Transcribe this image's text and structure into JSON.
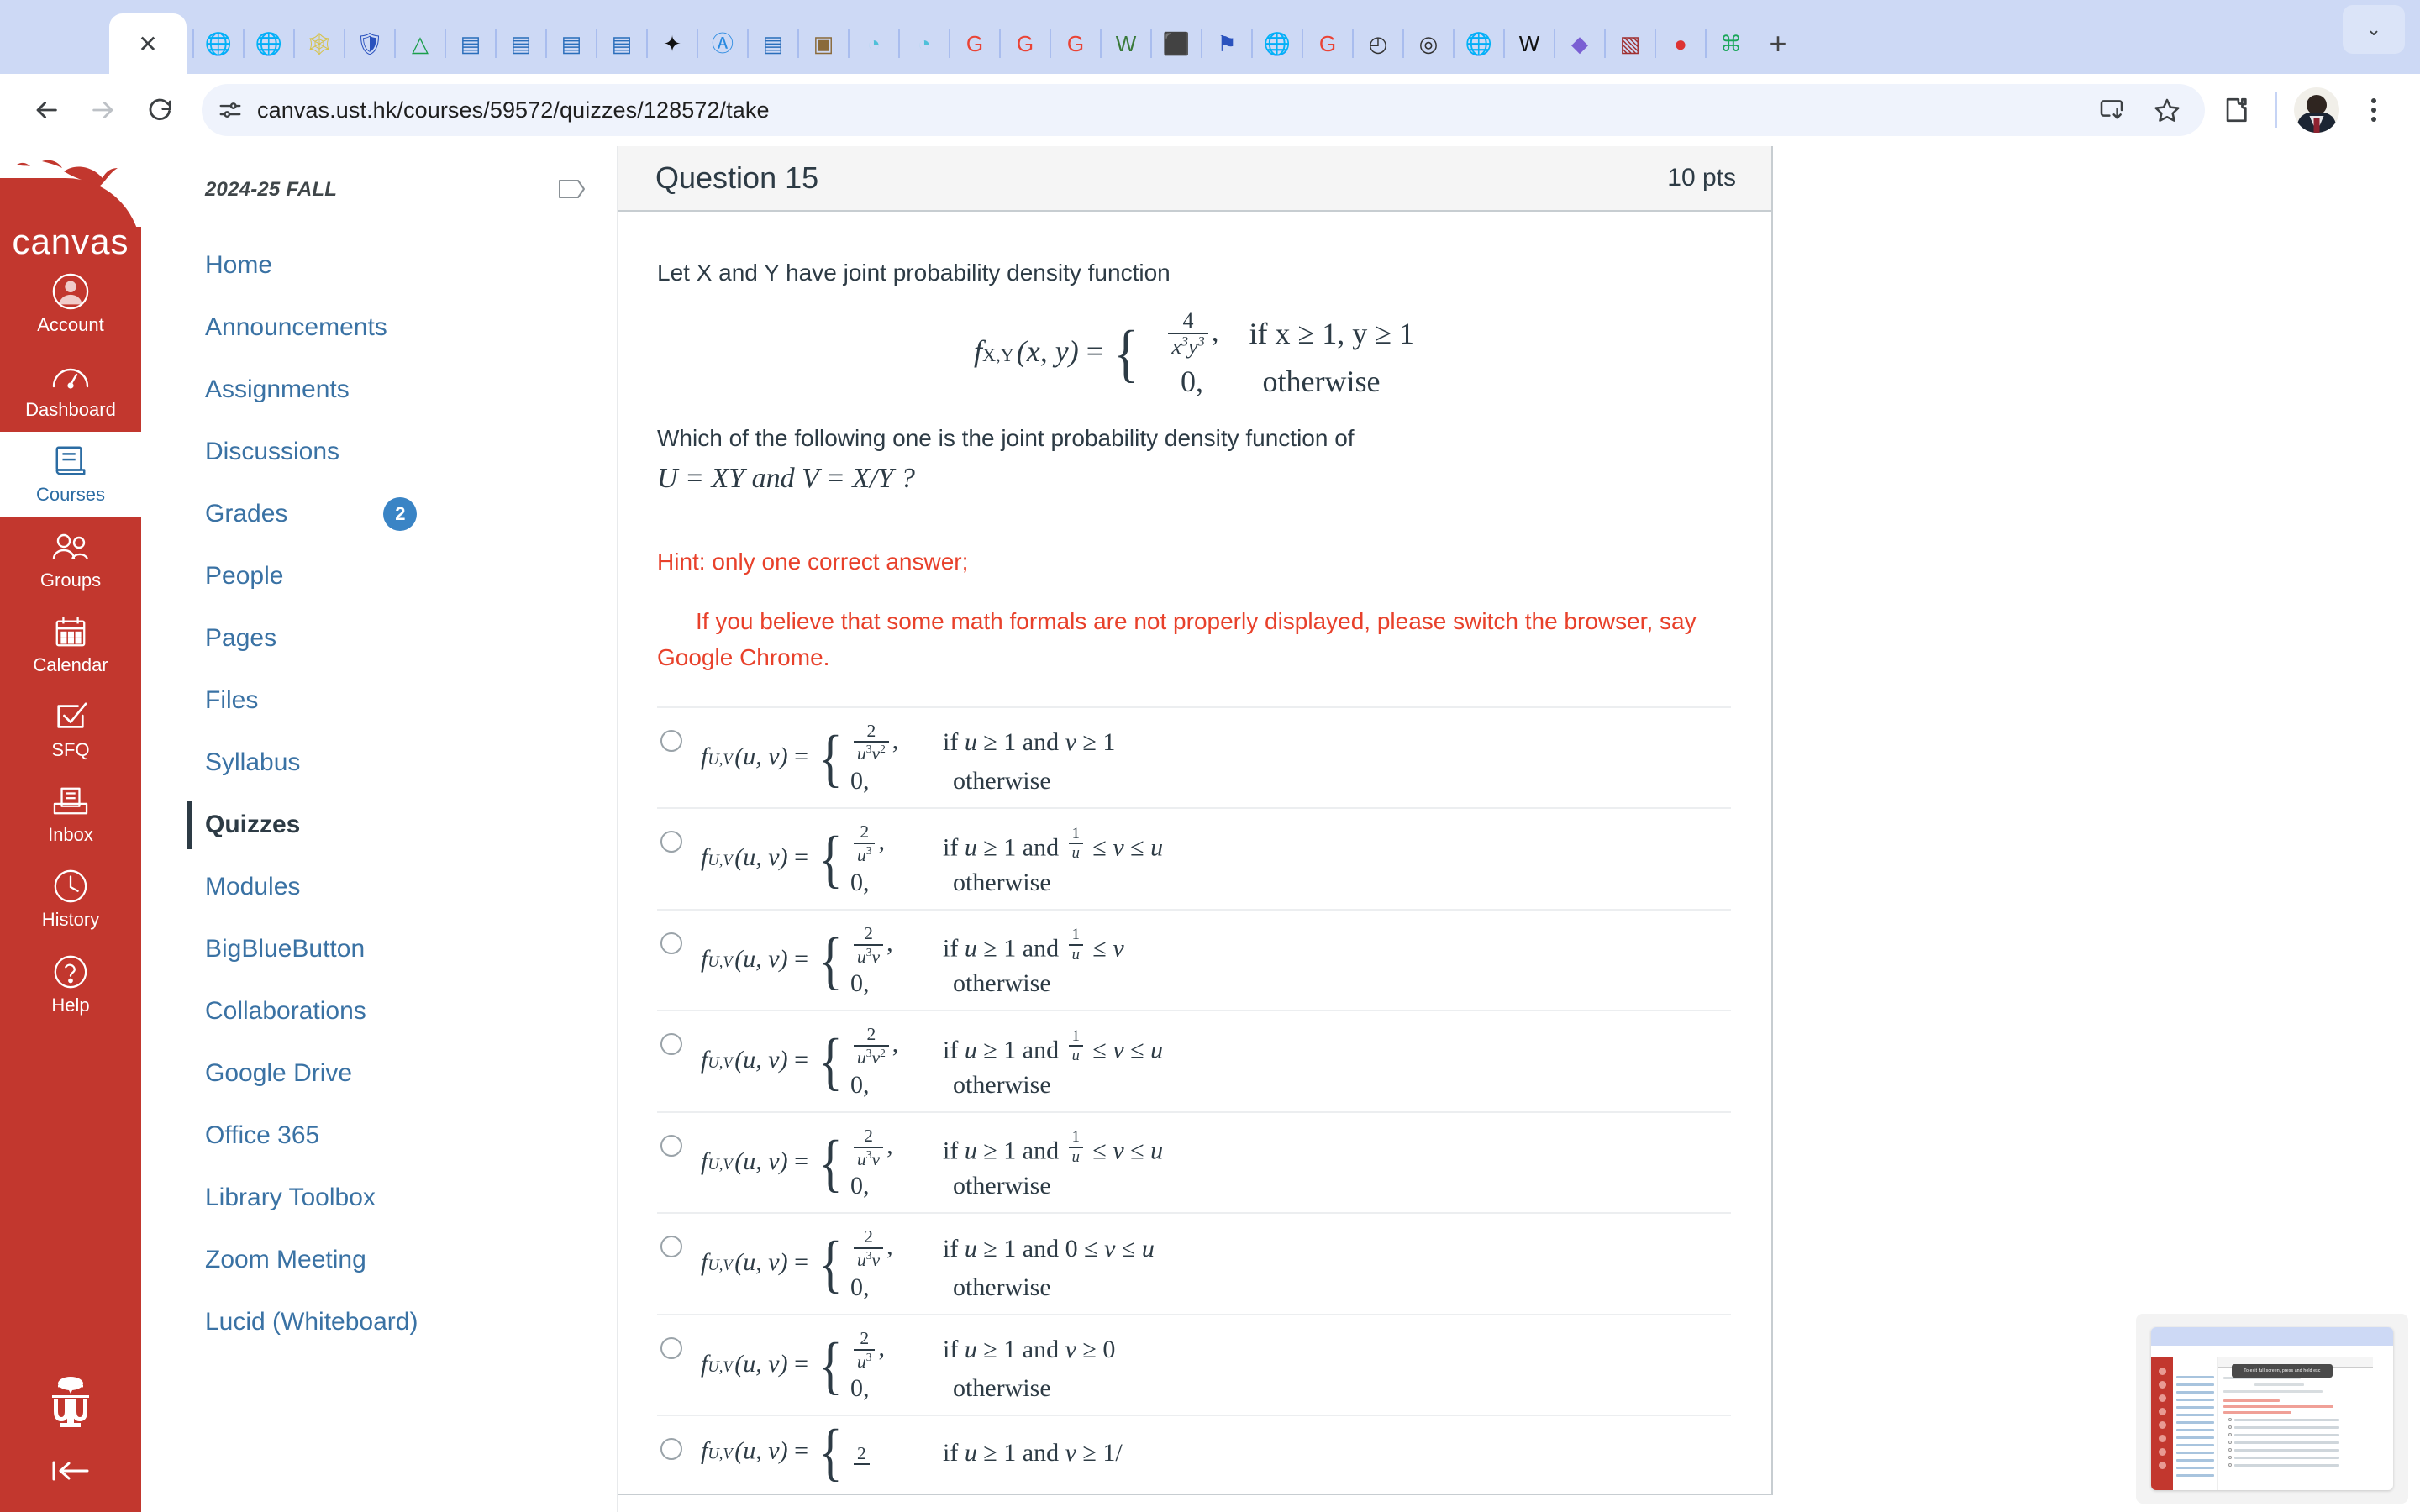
{
  "browser": {
    "active_tab_label": "✕",
    "new_tab_label": "+",
    "tab_chevron": "⌄",
    "back_icon": "back-arrow",
    "forward_icon": "forward-arrow",
    "reload_icon": "reload",
    "url": "canvas.ust.hk/courses/59572/quizzes/128572/take",
    "bookmarks": [
      {
        "name": "globe-dark",
        "glyph": "🌐"
      },
      {
        "name": "globe-dark-2",
        "glyph": "🌐"
      },
      {
        "name": "spider-web",
        "glyph": "🕸"
      },
      {
        "name": "blue-shield",
        "glyph": "🛡"
      },
      {
        "name": "google-drive",
        "glyph": "△"
      },
      {
        "name": "canvas-blue",
        "glyph": "▤"
      },
      {
        "name": "canvas-blue-2",
        "glyph": "▤"
      },
      {
        "name": "document-blue",
        "glyph": "▤"
      },
      {
        "name": "document-blue-2",
        "glyph": "▤"
      },
      {
        "name": "black-icon",
        "glyph": "✦"
      },
      {
        "name": "app-store",
        "glyph": "Ⓐ"
      },
      {
        "name": "canvas-blue-3",
        "glyph": "▤"
      },
      {
        "name": "photo-thumb",
        "glyph": "▣"
      },
      {
        "name": "robot-face",
        "glyph": "◔"
      },
      {
        "name": "robot-face-2",
        "glyph": "◔"
      },
      {
        "name": "google-g",
        "glyph": "G"
      },
      {
        "name": "google-g-2",
        "glyph": "G"
      },
      {
        "name": "google-g-3",
        "glyph": "G"
      },
      {
        "name": "word-w",
        "glyph": "W"
      },
      {
        "name": "box-3d",
        "glyph": "⬛"
      },
      {
        "name": "blue-flag",
        "glyph": "⚑"
      },
      {
        "name": "globe-dark-3",
        "glyph": "🌐"
      },
      {
        "name": "google-g-4",
        "glyph": "G"
      },
      {
        "name": "clock-outline",
        "glyph": "◴"
      },
      {
        "name": "chrome-dark",
        "glyph": "◎"
      },
      {
        "name": "globe-dark-4",
        "glyph": "🌐"
      },
      {
        "name": "wikipedia-w",
        "glyph": "W"
      },
      {
        "name": "gem-gradient",
        "glyph": "◆"
      },
      {
        "name": "crest-shield",
        "glyph": "▧"
      },
      {
        "name": "pokeball",
        "glyph": "●"
      },
      {
        "name": "green-app",
        "glyph": "⌘"
      }
    ],
    "toolbar_right": {
      "install_icon": "install-app",
      "bookmark_icon": "bookmark-star",
      "extensions_icon": "extensions-puzzle",
      "profile_icon": "profile-avatar",
      "menu_icon": "three-dot-menu"
    }
  },
  "globalnav": {
    "logo": "canvas",
    "items": [
      {
        "label": "Account",
        "icon": "user-circle-icon",
        "active": false
      },
      {
        "label": "Dashboard",
        "icon": "dashboard-gauge-icon",
        "active": false
      },
      {
        "label": "Courses",
        "icon": "book-icon",
        "active": true
      },
      {
        "label": "Groups",
        "icon": "people-icon",
        "active": false
      },
      {
        "label": "Calendar",
        "icon": "calendar-icon",
        "active": false
      },
      {
        "label": "SFQ",
        "icon": "checkbox-checked-icon",
        "active": false
      },
      {
        "label": "Inbox",
        "icon": "inbox-tray-icon",
        "active": false
      },
      {
        "label": "History",
        "icon": "clock-icon",
        "active": false
      },
      {
        "label": "Help",
        "icon": "question-circle-icon",
        "active": false
      }
    ],
    "footer_logo": "ust-crest-icon",
    "collapse_icon": "collapse-left-icon"
  },
  "coursenav": {
    "term": "2024-25 FALL",
    "flag_icon": "flag-outline-icon",
    "items": [
      {
        "label": "Home",
        "badge": "",
        "active": false
      },
      {
        "label": "Announcements",
        "badge": "",
        "active": false
      },
      {
        "label": "Assignments",
        "badge": "",
        "active": false
      },
      {
        "label": "Discussions",
        "badge": "",
        "active": false
      },
      {
        "label": "Grades",
        "badge": "2",
        "active": false
      },
      {
        "label": "People",
        "badge": "",
        "active": false
      },
      {
        "label": "Pages",
        "badge": "",
        "active": false
      },
      {
        "label": "Files",
        "badge": "",
        "active": false
      },
      {
        "label": "Syllabus",
        "badge": "",
        "active": false
      },
      {
        "label": "Quizzes",
        "badge": "",
        "active": true
      },
      {
        "label": "Modules",
        "badge": "",
        "active": false
      },
      {
        "label": "BigBlueButton",
        "badge": "",
        "active": false
      },
      {
        "label": "Collaborations",
        "badge": "",
        "active": false
      },
      {
        "label": "Google Drive",
        "badge": "",
        "active": false
      },
      {
        "label": "Office 365",
        "badge": "",
        "active": false
      },
      {
        "label": "Library Toolbox",
        "badge": "",
        "active": false
      },
      {
        "label": "Zoom Meeting",
        "badge": "",
        "active": false
      },
      {
        "label": "Lucid (Whiteboard)",
        "badge": "",
        "active": false
      }
    ]
  },
  "question": {
    "title": "Question 15",
    "points": "10 pts",
    "intro": "Let X and Y have joint probability density function",
    "formula": {
      "lhs": "f",
      "lhs_sub": "X,Y",
      "lhs_args": "(x, y) =",
      "case1_value_num": "4",
      "case1_value_den": "x³y³",
      "case1_cond": "if x ≥ 1, y ≥ 1",
      "case2_value": "0,",
      "case2_cond": "otherwise"
    },
    "prompt_line1": "Which of the following one is the joint probability density function of",
    "prompt_line2": "U = XY and V = X/Y ?",
    "hint_line1": "Hint: only one correct answer;",
    "hint_line2": "If you believe that some math formals are not properly displayed, please switch the browser, say Google Chrome.",
    "hint_color": "#e8412b",
    "answers": [
      {
        "num": "2",
        "den": "u³v²",
        "cond": "if u ≥ 1 and v ≥ 1",
        "zero": "0,",
        "otherwise": "otherwise",
        "selected": false
      },
      {
        "num": "2",
        "den": "u³",
        "cond": "if u ≥ 1 and 1/u ≤ v ≤ u",
        "zero": "0,",
        "otherwise": "otherwise",
        "selected": false
      },
      {
        "num": "2",
        "den": "u³v",
        "cond": "if u ≥ 1 and 1/u ≤ v",
        "zero": "0,",
        "otherwise": "otherwise",
        "selected": false
      },
      {
        "num": "2",
        "den": "u³v²",
        "cond": "if u ≥ 1 and 1/u ≤ v ≤ u",
        "zero": "0,",
        "otherwise": "otherwise",
        "selected": false
      },
      {
        "num": "2",
        "den": "u³v",
        "cond": "if u ≥ 1 and 1/u ≤ v ≤ u",
        "zero": "0,",
        "otherwise": "otherwise",
        "selected": false
      },
      {
        "num": "2",
        "den": "u³v",
        "cond": "if u ≥ 1 and 0 ≤ v ≤ u",
        "zero": "0,",
        "otherwise": "otherwise",
        "selected": false
      },
      {
        "num": "2",
        "den": "u³",
        "cond": "if u ≥ 1 and v ≥ 0",
        "zero": "0,",
        "otherwise": "otherwise",
        "selected": false
      },
      {
        "num": "2",
        "den": "",
        "cond": "if u ≥ 1 and v ≥ 1/",
        "zero": "",
        "otherwise": "",
        "selected": false
      }
    ]
  },
  "preview": {
    "tooltip": "To exit full screen, press and hold esc"
  }
}
